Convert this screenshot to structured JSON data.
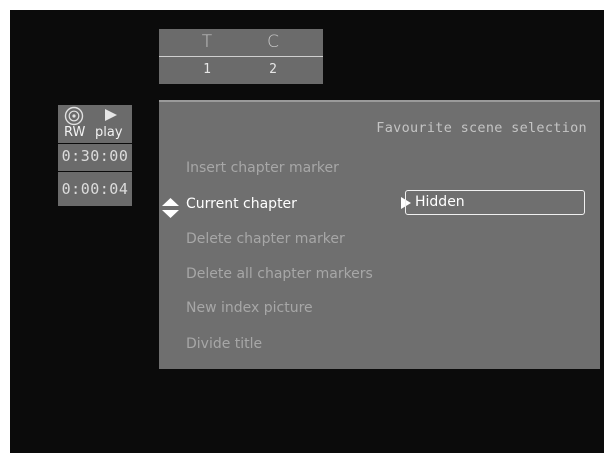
{
  "title_chapter": {
    "title_label": "T",
    "chapter_label": "C",
    "title_value": "1",
    "chapter_value": "2"
  },
  "status": {
    "disc_icon": "disc-icon",
    "play_icon": "play-icon",
    "disc_type": "RW",
    "play_label": "play",
    "total_time": "0:30:00",
    "elapsed_time": "0:00:04"
  },
  "menu": {
    "title": "Favourite scene selection",
    "items": [
      {
        "label": "Insert chapter marker",
        "active": false
      },
      {
        "label": "Current chapter",
        "active": true
      },
      {
        "label": "Delete chapter marker",
        "active": false
      },
      {
        "label": "Delete all chapter markers",
        "active": false
      },
      {
        "label": "New index picture",
        "active": false
      },
      {
        "label": "Divide title",
        "active": false
      }
    ],
    "current_value": "Hidden",
    "selector_icon": "up-down-arrows-icon",
    "value_icon": "right-triangle-icon"
  },
  "colors": {
    "background": "#0b0b0b",
    "panel": "#6f6f6f",
    "inactive_text": "#a7a7a7",
    "active_text": "#ffffff"
  }
}
